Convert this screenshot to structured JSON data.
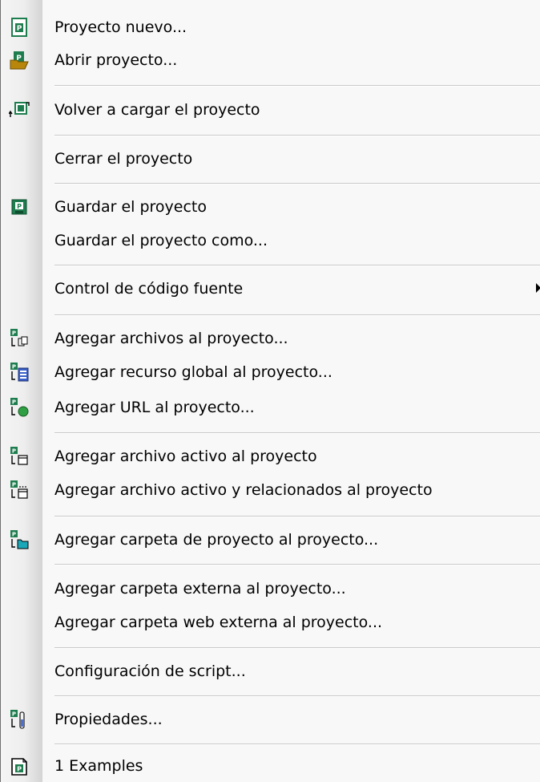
{
  "menu": {
    "items": [
      {
        "id": "new",
        "label": "Proyecto nuevo...",
        "icon": "new-project-icon"
      },
      {
        "id": "open",
        "label": "Abrir proyecto...",
        "icon": "open-project-icon"
      },
      {
        "id": "reload",
        "label": "Volver a cargar el proyecto",
        "icon": "reload-project-icon"
      },
      {
        "id": "close",
        "label": "Cerrar el proyecto",
        "icon": null
      },
      {
        "id": "save",
        "label": "Guardar el proyecto",
        "icon": "save-project-icon"
      },
      {
        "id": "save_as",
        "label": "Guardar el proyecto como...",
        "icon": null
      },
      {
        "id": "source_control",
        "label": "Control de código fuente",
        "icon": null,
        "submenu": true
      },
      {
        "id": "add_files",
        "label": "Agregar archivos al proyecto...",
        "icon": "add-files-icon"
      },
      {
        "id": "add_global",
        "label": "Agregar recurso global al proyecto...",
        "icon": "add-global-resource-icon"
      },
      {
        "id": "add_url",
        "label": "Agregar URL al proyecto...",
        "icon": "add-url-icon"
      },
      {
        "id": "add_active",
        "label": "Agregar archivo activo al proyecto",
        "icon": "add-active-file-icon"
      },
      {
        "id": "add_active_related",
        "label": "Agregar archivo activo y relacionados al proyecto",
        "icon": "add-active-related-icon"
      },
      {
        "id": "add_project_folder",
        "label": "Agregar carpeta de proyecto al proyecto...",
        "icon": "add-project-folder-icon"
      },
      {
        "id": "add_ext_folder",
        "label": "Agregar carpeta externa al proyecto...",
        "icon": null
      },
      {
        "id": "add_ext_web_folder",
        "label": "Agregar carpeta web externa al proyecto...",
        "icon": null
      },
      {
        "id": "script_config",
        "label": "Configuración de script...",
        "icon": null
      },
      {
        "id": "properties",
        "label": "Propiedades...",
        "icon": "properties-icon"
      },
      {
        "id": "recent_1",
        "label": "1 Examples",
        "icon": "recent-project-icon"
      }
    ]
  },
  "colors": {
    "project_green": "#1e7d4e",
    "text": "#000000",
    "separator": "#c9c9c9"
  }
}
